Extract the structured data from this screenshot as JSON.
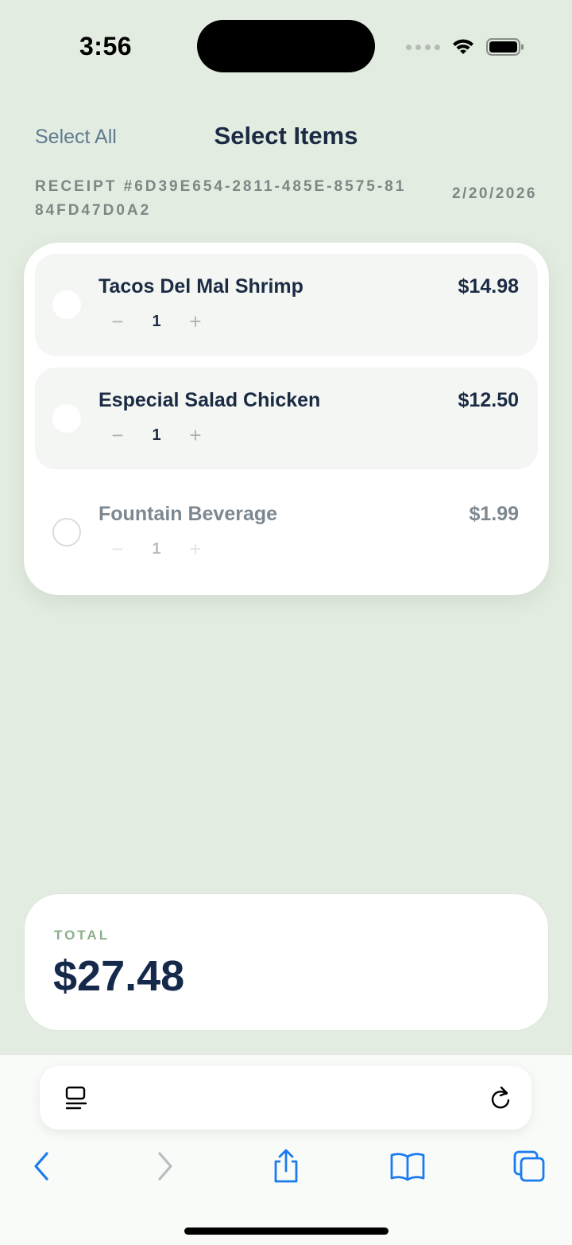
{
  "status": {
    "time": "3:56"
  },
  "header": {
    "select_all": "Select All",
    "title": "Select Items"
  },
  "receipt": {
    "id": "RECEIPT #6D39E654-2811-485E-8575-8184FD47D0A2",
    "date": "2/20/2026"
  },
  "items": [
    {
      "name": "Tacos Del Mal Shrimp",
      "price": "$14.98",
      "qty": "1",
      "selected": true
    },
    {
      "name": "Especial Salad Chicken",
      "price": "$12.50",
      "qty": "1",
      "selected": true
    },
    {
      "name": "Fountain Beverage",
      "price": "$1.99",
      "qty": "1",
      "selected": false
    }
  ],
  "qty_controls": {
    "minus": "−",
    "plus": "+"
  },
  "total": {
    "label": "TOTAL",
    "value": "$27.48"
  },
  "browser": {
    "icons": [
      "tabs-overview-icon",
      "reload-icon",
      "back-icon",
      "forward-icon",
      "share-icon",
      "bookmarks-icon",
      "tabs-icon"
    ],
    "accent": "#1a7bf0"
  },
  "colors": {
    "background": "#e3ece0",
    "title": "#1b2b44",
    "total_label": "#8bb08a"
  }
}
